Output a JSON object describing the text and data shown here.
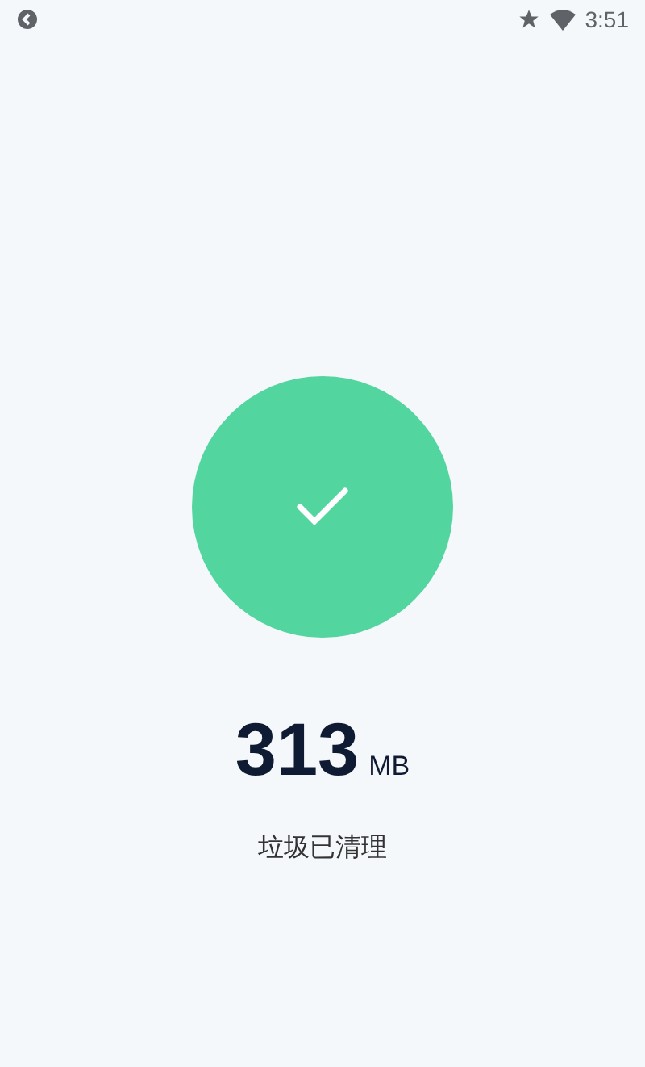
{
  "status_bar": {
    "time": "3:51"
  },
  "result": {
    "amount": "313",
    "unit": "MB",
    "caption": "垃圾已清理"
  }
}
